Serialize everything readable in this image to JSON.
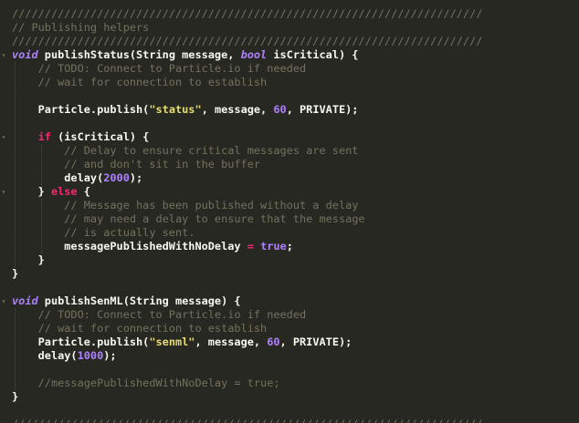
{
  "editor": {
    "theme_colors": {
      "background": "#272822",
      "comment": "#75715e",
      "keyword": "#ae81ff",
      "flow_keyword": "#f92672",
      "string": "#e6db74",
      "number": "#ae81ff",
      "plain": "#f8f8f2"
    },
    "lines": [
      {
        "fold": "",
        "tokens": [
          {
            "t": "c",
            "v": "////////////////////////////////////////////////////////////////////////"
          }
        ]
      },
      {
        "fold": "",
        "tokens": [
          {
            "t": "c",
            "v": "// Publishing helpers"
          }
        ]
      },
      {
        "fold": "",
        "tokens": [
          {
            "t": "c",
            "v": "////////////////////////////////////////////////////////////////////////"
          }
        ]
      },
      {
        "fold": "▾",
        "tokens": [
          {
            "t": "k",
            "v": "void"
          },
          {
            "t": "p",
            "v": " publishStatus(String message, "
          },
          {
            "t": "k",
            "v": "bool"
          },
          {
            "t": "p",
            "v": " isCritical) {"
          }
        ]
      },
      {
        "fold": "",
        "tokens": [
          {
            "t": "c",
            "v": "    // TODO: Connect to Particle.io if needed"
          }
        ]
      },
      {
        "fold": "",
        "tokens": [
          {
            "t": "c",
            "v": "    // wait for connection to establish"
          }
        ]
      },
      {
        "fold": "",
        "tokens": []
      },
      {
        "fold": "",
        "tokens": [
          {
            "t": "p",
            "v": "    Particle.publish("
          },
          {
            "t": "s",
            "v": "\"status\""
          },
          {
            "t": "p",
            "v": ", message, "
          },
          {
            "t": "n",
            "v": "60"
          },
          {
            "t": "p",
            "v": ", PRIVATE);"
          }
        ]
      },
      {
        "fold": "",
        "tokens": []
      },
      {
        "fold": "▾",
        "tokens": [
          {
            "t": "f",
            "v": "    if"
          },
          {
            "t": "p",
            "v": " (isCritical) {"
          }
        ]
      },
      {
        "fold": "",
        "tokens": [
          {
            "t": "c",
            "v": "        // Delay to ensure critical messages are sent"
          }
        ]
      },
      {
        "fold": "",
        "tokens": [
          {
            "t": "c",
            "v": "        // and don't sit in the buffer"
          }
        ]
      },
      {
        "fold": "",
        "tokens": [
          {
            "t": "p",
            "v": "        delay("
          },
          {
            "t": "n",
            "v": "2000"
          },
          {
            "t": "p",
            "v": ");"
          }
        ]
      },
      {
        "fold": "▾",
        "tokens": [
          {
            "t": "p",
            "v": "    } "
          },
          {
            "t": "f",
            "v": "else"
          },
          {
            "t": "p",
            "v": " {"
          }
        ]
      },
      {
        "fold": "",
        "tokens": [
          {
            "t": "c",
            "v": "        // Message has been published without a delay"
          }
        ]
      },
      {
        "fold": "",
        "tokens": [
          {
            "t": "c",
            "v": "        // may need a delay to ensure that the message"
          }
        ]
      },
      {
        "fold": "",
        "tokens": [
          {
            "t": "c",
            "v": "        // is actually sent."
          }
        ]
      },
      {
        "fold": "",
        "tokens": [
          {
            "t": "p",
            "v": "        messagePublishedWithNoDelay "
          },
          {
            "t": "o",
            "v": "="
          },
          {
            "t": "p",
            "v": " "
          },
          {
            "t": "n",
            "v": "true"
          },
          {
            "t": "p",
            "v": ";"
          }
        ]
      },
      {
        "fold": "",
        "tokens": [
          {
            "t": "p",
            "v": "    }"
          }
        ]
      },
      {
        "fold": "",
        "tokens": [
          {
            "t": "p",
            "v": "}"
          }
        ]
      },
      {
        "fold": "",
        "tokens": []
      },
      {
        "fold": "▾",
        "tokens": [
          {
            "t": "k",
            "v": "void"
          },
          {
            "t": "p",
            "v": " publishSenML(String message) {"
          }
        ]
      },
      {
        "fold": "",
        "tokens": [
          {
            "t": "c",
            "v": "    // TODO: Connect to Particle.io if needed"
          }
        ]
      },
      {
        "fold": "",
        "tokens": [
          {
            "t": "c",
            "v": "    // wait for connection to establish"
          }
        ]
      },
      {
        "fold": "",
        "tokens": [
          {
            "t": "p",
            "v": "    Particle.publish("
          },
          {
            "t": "s",
            "v": "\"senml\""
          },
          {
            "t": "p",
            "v": ", message, "
          },
          {
            "t": "n",
            "v": "60"
          },
          {
            "t": "p",
            "v": ", PRIVATE);"
          }
        ]
      },
      {
        "fold": "",
        "tokens": [
          {
            "t": "p",
            "v": "    delay("
          },
          {
            "t": "n",
            "v": "1000"
          },
          {
            "t": "p",
            "v": ");"
          }
        ]
      },
      {
        "fold": "",
        "tokens": []
      },
      {
        "fold": "",
        "tokens": [
          {
            "t": "c",
            "v": "    //messagePublishedWithNoDelay = true;"
          }
        ]
      },
      {
        "fold": "",
        "tokens": [
          {
            "t": "p",
            "v": "}"
          }
        ]
      },
      {
        "fold": "",
        "tokens": []
      },
      {
        "fold": "",
        "tokens": [
          {
            "t": "c",
            "v": "////////////////////////////////////////////////////////////////////////"
          }
        ]
      }
    ]
  }
}
